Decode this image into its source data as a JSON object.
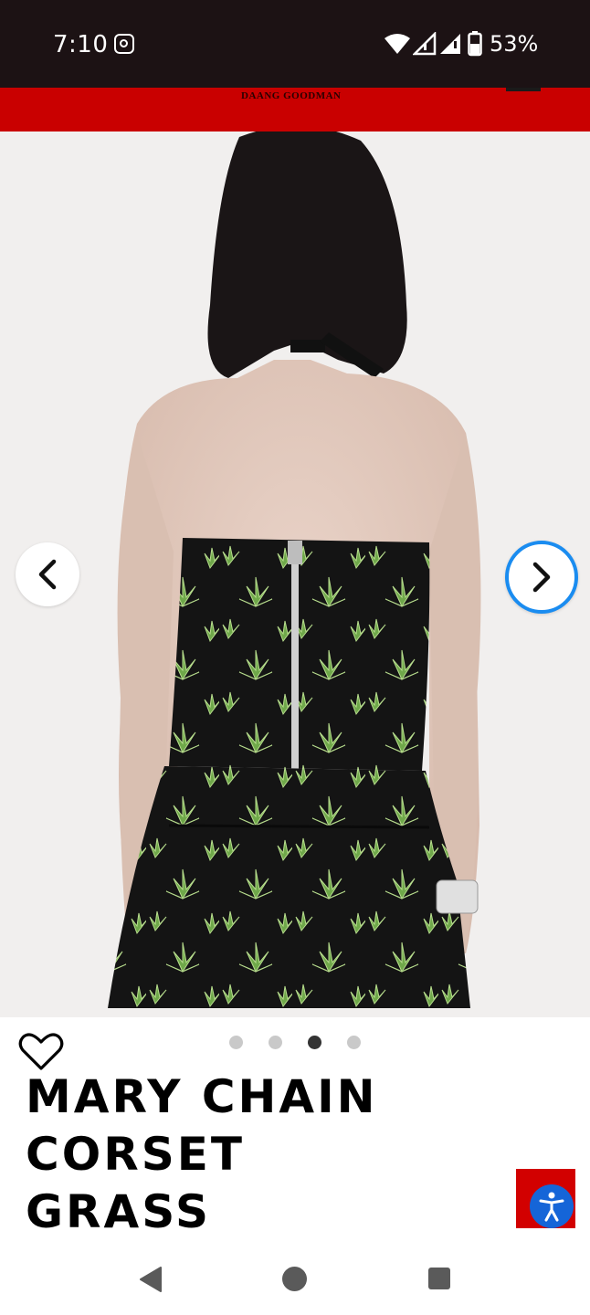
{
  "status_bar": {
    "time": "7:10",
    "battery": "53%",
    "icons": [
      "instagram-icon",
      "wifi-icon",
      "signal-icon",
      "signal-icon",
      "battery-icon"
    ]
  },
  "site_header": {
    "brand_subtitle": "DAANG GOODMAN",
    "background_color": "#c90000"
  },
  "product": {
    "title_lines": [
      "MARY CHAIN",
      "CORSET",
      "GRASS"
    ],
    "image_alt": "",
    "carousel": {
      "total": 4,
      "active_index": 2
    }
  },
  "colors": {
    "accent_blue": "#1a8cf0",
    "a11y_blue": "#1565d8",
    "a11y_red": "#d20000"
  }
}
